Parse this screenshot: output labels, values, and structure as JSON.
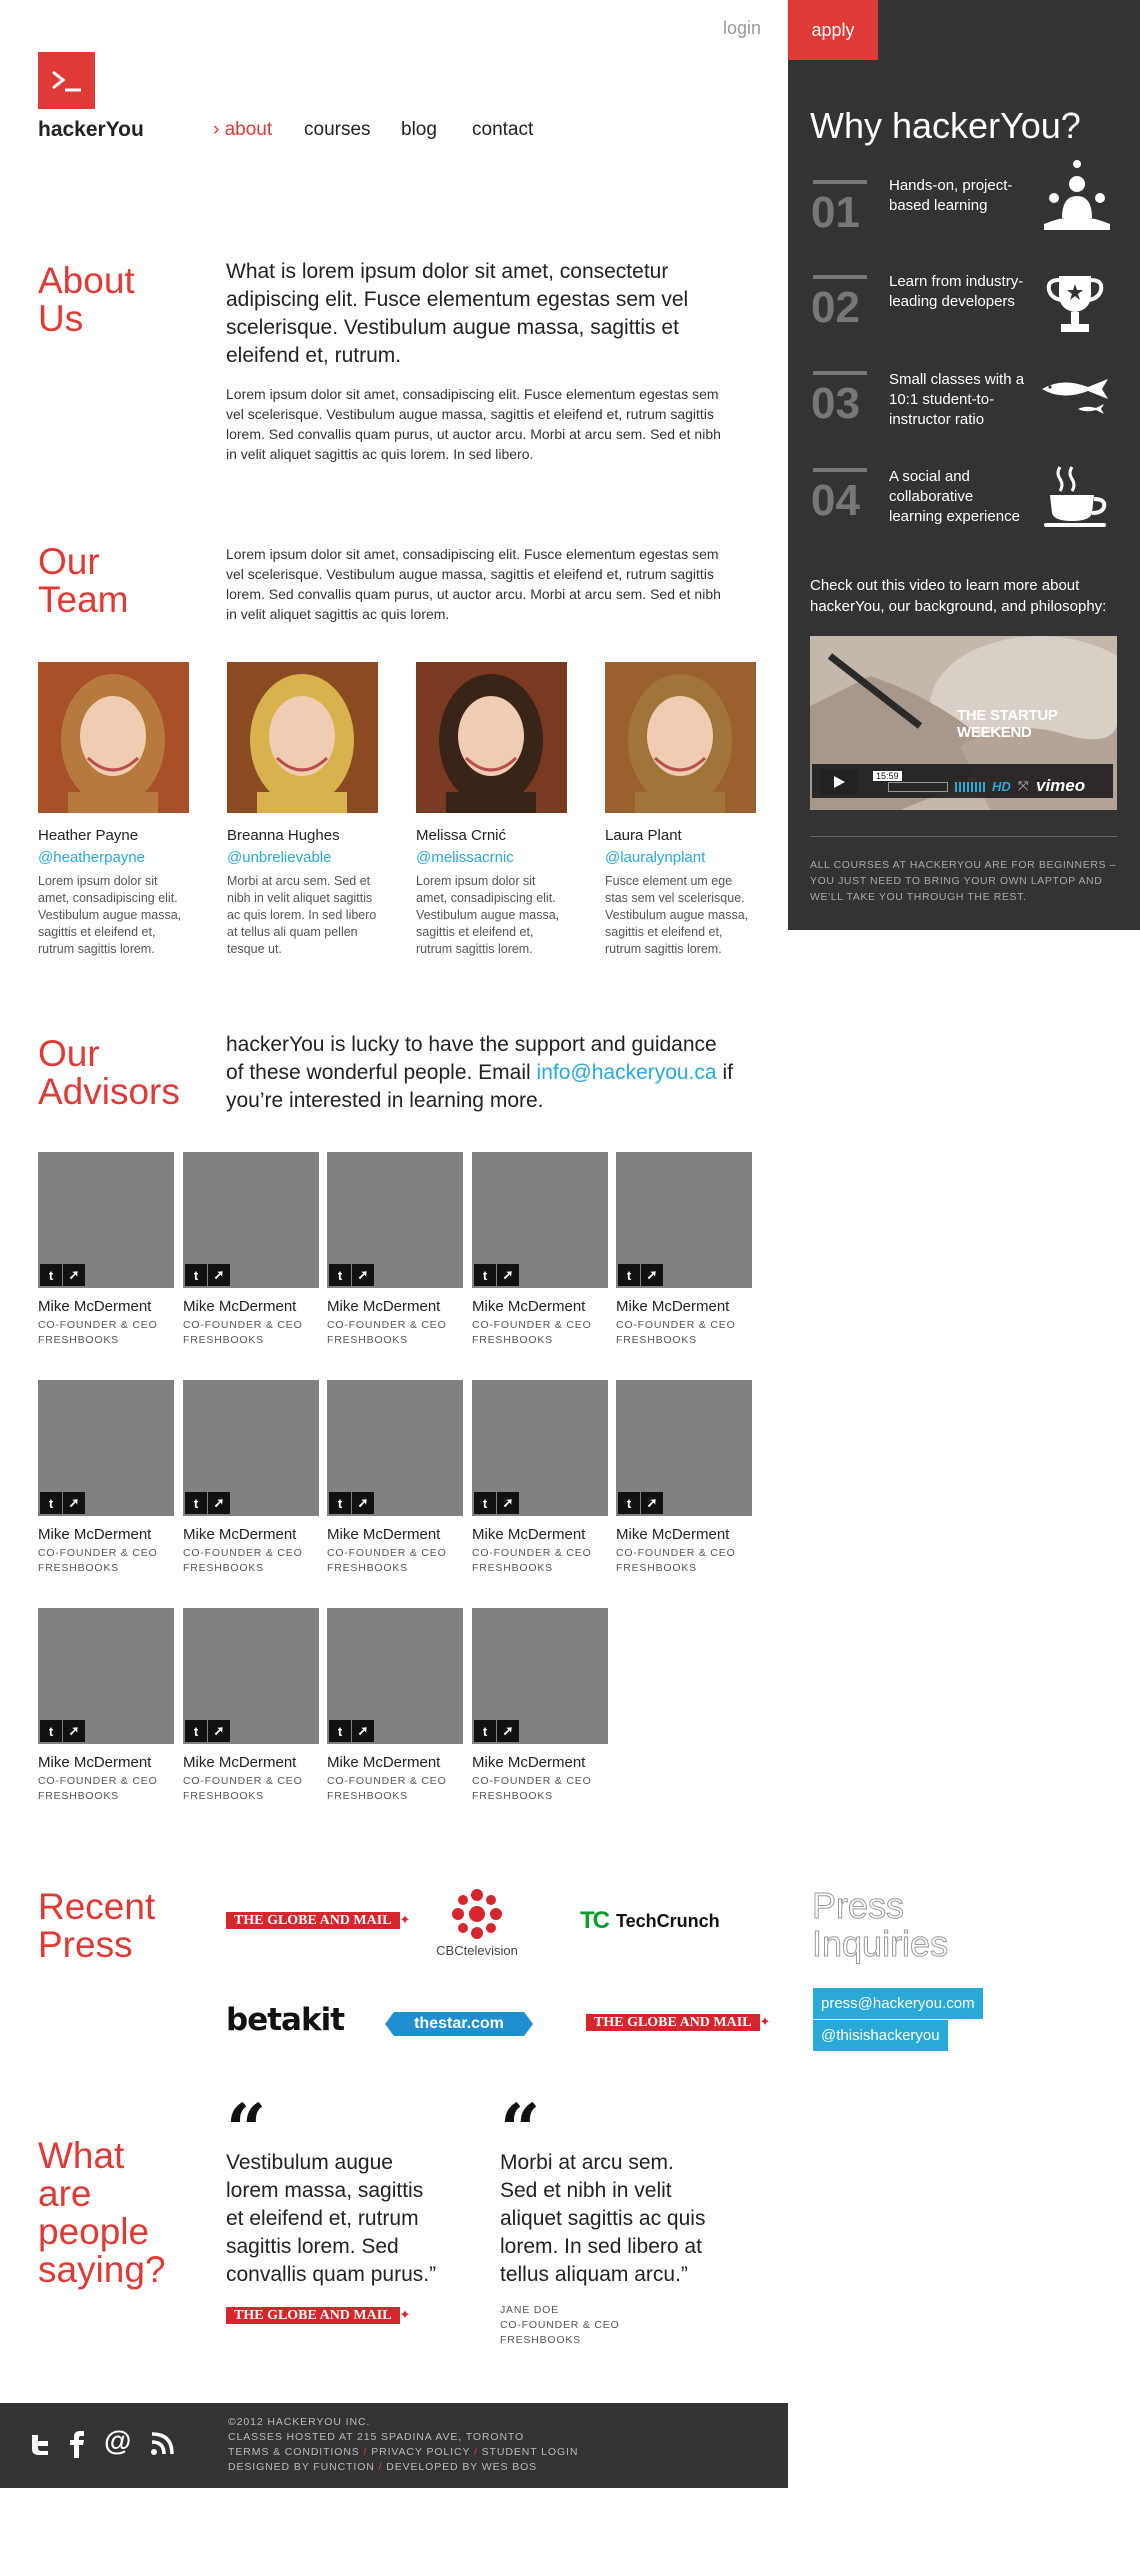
{
  "header": {
    "brand": "hackerYou",
    "logo_glyph": ">_",
    "login": "login",
    "apply": "apply",
    "nav": [
      {
        "label": "about",
        "marker": "›",
        "active": true
      },
      {
        "label": "courses"
      },
      {
        "label": "blog"
      },
      {
        "label": "contact"
      }
    ]
  },
  "sidebar": {
    "title": "Why hackerYou?",
    "items": [
      {
        "num": "01",
        "text": "Hands-on, project-based learning",
        "icon": "group-learning-icon"
      },
      {
        "num": "02",
        "text": "Learn from industry-leading developers",
        "icon": "trophy-icon"
      },
      {
        "num": "03",
        "text": "Small classes with a 10:1 student-to-instructor ratio",
        "icon": "fish-icon"
      },
      {
        "num": "04",
        "text": "A social and collaborative learning experience",
        "icon": "coffee-cup-icon"
      }
    ],
    "video_blurb": "Check out this video to learn more about hackerYou, our background, and philosophy:",
    "video": {
      "title": "THE STARTUP WEEKEND",
      "time": "15:59",
      "hd": "HD",
      "provider": "vimeo"
    },
    "note": "ALL COURSES AT HACKERYOU ARE FOR BEGINNERS – YOU JUST NEED TO BRING YOUR OWN LAPTOP AND WE'LL TAKE YOU THROUGH THE REST."
  },
  "about": {
    "title_line1": "About",
    "title_line2": "Us",
    "lead": "What is lorem ipsum dolor sit amet, consectetur adipiscing elit. Fusce elementum egestas sem vel scelerisque. Vestibulum augue massa, sagittis et eleifend et, rutrum.",
    "body": "Lorem ipsum dolor sit amet, consadipiscing elit. Fusce elementum egestas sem vel scelerisque. Vestibulum augue massa, sagittis et eleifend et, rutrum sagittis lorem. Sed convallis quam purus, ut auctor arcu. Morbi at arcu sem. Sed et nibh in velit aliquet sagittis ac quis lorem. In sed libero."
  },
  "team": {
    "title_line1": "Our",
    "title_line2": "Team",
    "body": "Lorem ipsum dolor sit amet, consadipiscing elit. Fusce elementum egestas sem vel scelerisque. Vestibulum augue massa, sagittis et eleifend et, rutrum sagittis lorem. Sed convallis quam purus, ut auctor arcu. Morbi at arcu sem. Sed et nibh in velit aliquet sagittis ac quis lorem.",
    "members": [
      {
        "name": "Heather Payne",
        "handle": "@heatherpayne",
        "bio": "Lorem ipsum dolor sit amet, consadipiscing elit. Vestibulum augue massa, sagittis et eleifend et, rutrum sagittis lorem.",
        "hair": "#b57a3c",
        "bg": "#a8502a"
      },
      {
        "name": "Breanna Hughes",
        "handle": "@unbrelievable",
        "bio": "Morbi at arcu sem. Sed et nibh in velit aliquet sagittis ac quis lorem. In sed libero at tellus ali quam pellen tesque ut.",
        "hair": "#d9b24e",
        "bg": "#8a4a22"
      },
      {
        "name": "Melissa Crnić",
        "handle": "@melissacrnic",
        "bio": "Lorem ipsum dolor sit amet, consadipiscing elit. Vestibulum augue massa, sagittis et eleifend et, rutrum sagittis lorem.",
        "hair": "#3a2418",
        "bg": "#7a3a22"
      },
      {
        "name": "Laura Plant",
        "handle": "@lauralynplant",
        "bio": "Fusce element um ege stas sem vel scelerisque. Vestibulum augue massa, sagittis et eleifend et, rutrum sagittis lorem.",
        "hair": "#a3743a",
        "bg": "#9a6030"
      }
    ]
  },
  "advisors": {
    "title_line1": "Our",
    "title_line2": "Advisors",
    "lead_before": "hackerYou is lucky to have the support and guidance of these wonderful people. Email ",
    "email": "info@hackeryou.ca",
    "lead_after": " if you’re interested in learning more.",
    "people": [
      {
        "name": "Mike McDerment",
        "role1": "CO-FOUNDER & CEO",
        "role2": "FRESHBOOKS"
      },
      {
        "name": "Mike McDerment",
        "role1": "CO-FOUNDER & CEO",
        "role2": "FRESHBOOKS"
      },
      {
        "name": "Mike McDerment",
        "role1": "CO-FOUNDER & CEO",
        "role2": "FRESHBOOKS"
      },
      {
        "name": "Mike McDerment",
        "role1": "CO-FOUNDER & CEO",
        "role2": "FRESHBOOKS"
      },
      {
        "name": "Mike McDerment",
        "role1": "CO-FOUNDER & CEO",
        "role2": "FRESHBOOKS"
      },
      {
        "name": "Mike McDerment",
        "role1": "CO-FOUNDER & CEO",
        "role2": "FRESHBOOKS"
      },
      {
        "name": "Mike McDerment",
        "role1": "CO-FOUNDER & CEO",
        "role2": "FRESHBOOKS"
      },
      {
        "name": "Mike McDerment",
        "role1": "CO-FOUNDER & CEO",
        "role2": "FRESHBOOKS"
      },
      {
        "name": "Mike McDerment",
        "role1": "CO-FOUNDER & CEO",
        "role2": "FRESHBOOKS"
      },
      {
        "name": "Mike McDerment",
        "role1": "CO-FOUNDER & CEO",
        "role2": "FRESHBOOKS"
      },
      {
        "name": "Mike McDerment",
        "role1": "CO-FOUNDER & CEO",
        "role2": "FRESHBOOKS"
      },
      {
        "name": "Mike McDerment",
        "role1": "CO-FOUNDER & CEO",
        "role2": "FRESHBOOKS"
      },
      {
        "name": "Mike McDerment",
        "role1": "CO-FOUNDER & CEO",
        "role2": "FRESHBOOKS"
      },
      {
        "name": "Mike McDerment",
        "role1": "CO-FOUNDER & CEO",
        "role2": "FRESHBOOKS"
      }
    ]
  },
  "press": {
    "title_line1": "Recent",
    "title_line2": "Press",
    "logos": {
      "globe": "THE GLOBE AND MAIL",
      "cbc": "CBCtelevision",
      "techcrunch": "TechCrunch",
      "techcrunch_mark": "TC",
      "betakit": "betakit",
      "thestar": "thestar.com"
    },
    "inquiries_line1": "Press",
    "inquiries_line2": "Inquiries",
    "email": "press@hackeryou.com",
    "twitter": "@thisishackeryou"
  },
  "testimonials": {
    "title_lines": [
      "What",
      "are",
      "people",
      "saying?"
    ],
    "quotes": [
      {
        "text": "Vestibulum augue lorem massa, sagittis et eleifend et, rutrum sagittis lorem. Sed convallis quam purus.”",
        "source": "THE GLOBE AND MAIL"
      },
      {
        "text": "Morbi at arcu sem. Sed et nibh in velit aliquet sagittis ac quis lorem. In sed libero at tellus aliquam arcu.”",
        "name": "JANE DOE",
        "role1": "CO-FOUNDER & CEO",
        "role2": "FRESHBOOKS"
      }
    ]
  },
  "footer": {
    "copyright": "©2012 HACKERYOU INC.",
    "address": "CLASSES HOSTED AT 215 SPADINA AVE, TORONTO",
    "links1": [
      "TERMS & CONDITIONS",
      "PRIVACY POLICY",
      "STUDENT LOGIN"
    ],
    "links2": [
      "DESIGNED BY FUNCTION",
      "DEVELOPED BY WES BOS"
    ],
    "separator": "/",
    "social": [
      "twitter-icon",
      "facebook-icon",
      "email-at-icon",
      "rss-icon"
    ]
  },
  "colors": {
    "accent": "#e03a36",
    "link": "#29a9d8",
    "sidebar": "#333333",
    "placeholder": "#818184"
  }
}
